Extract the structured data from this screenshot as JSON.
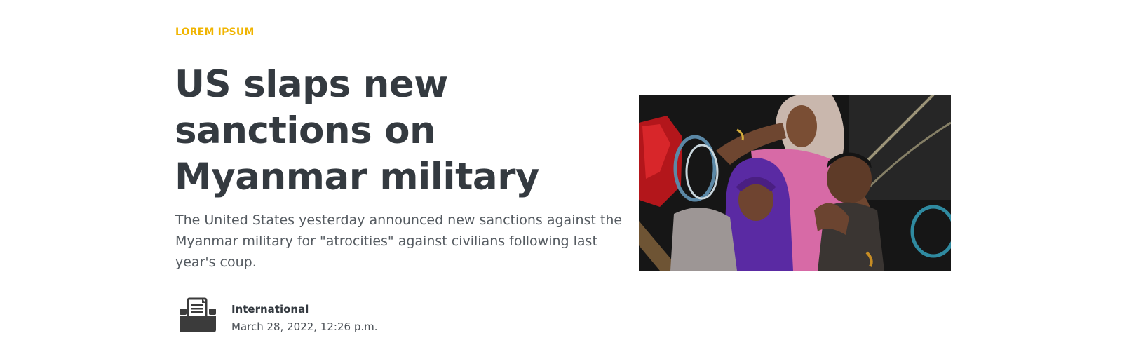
{
  "article": {
    "kicker": "LOREM IPSUM",
    "headline": "US slaps new sanctions on Myanmar military",
    "lede": "The United States yesterday announced new sanctions against the Myanmar military for \"atrocities\" against civilians following last year's coup.",
    "section": "International",
    "date": "March 28, 2022, 12:26 p.m."
  },
  "icons": {
    "section_icon": "newspaper-printer-icon"
  },
  "colors": {
    "kicker": "#f0b400",
    "headline": "#343a40",
    "body_text": "#555b61"
  }
}
